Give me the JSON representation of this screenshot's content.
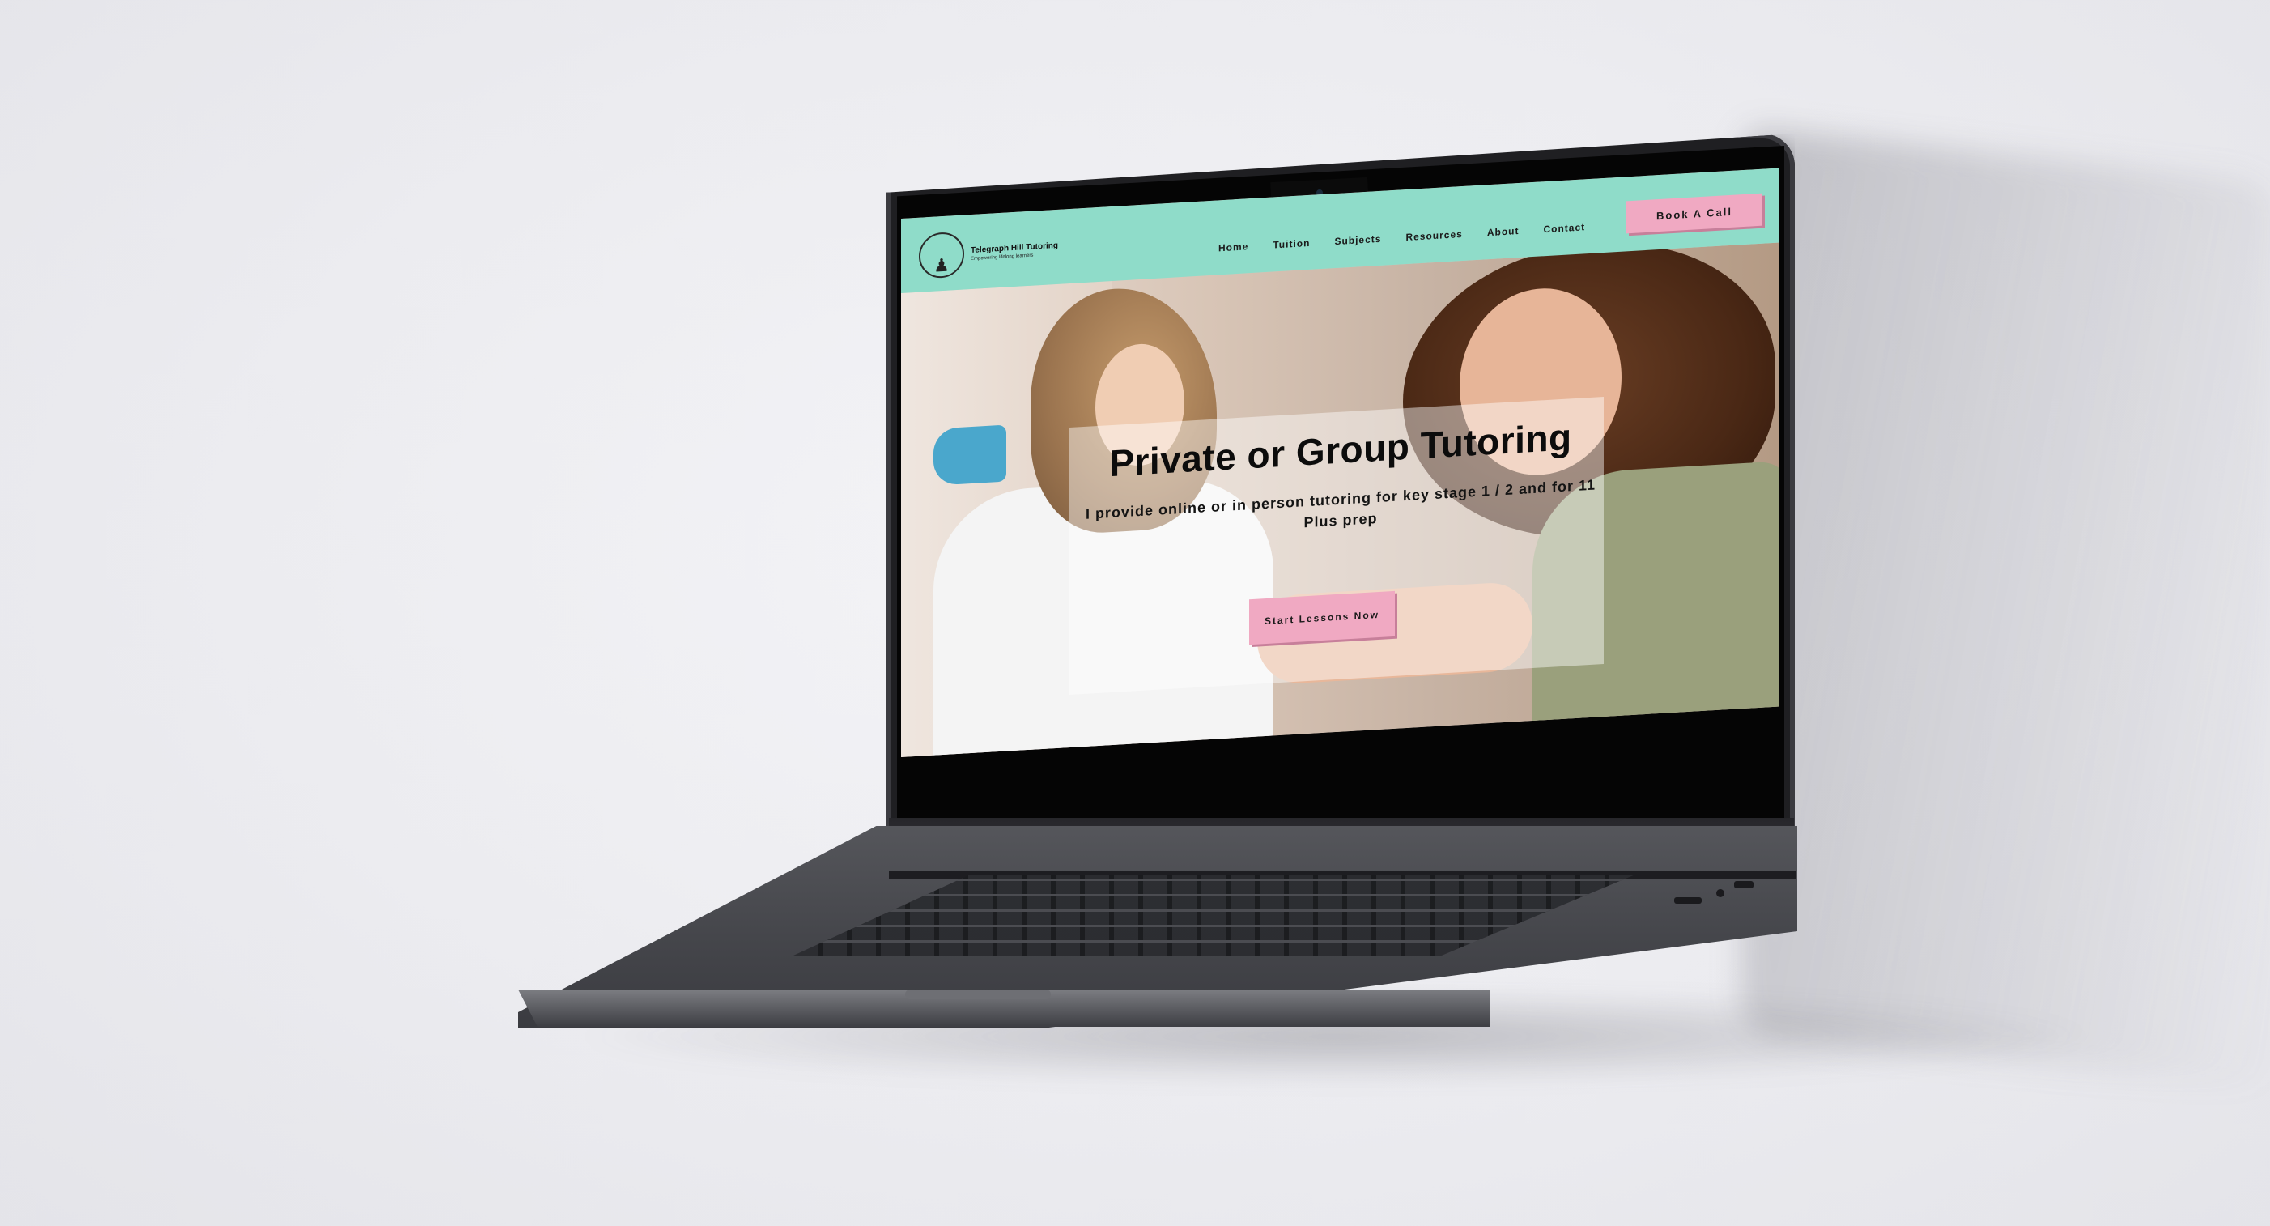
{
  "site": {
    "logo": {
      "title": "Telegraph Hill Tutoring",
      "subtitle": "Empowering lifelong learners"
    },
    "nav": [
      {
        "label": "Home"
      },
      {
        "label": "Tuition"
      },
      {
        "label": "Subjects"
      },
      {
        "label": "Resources"
      },
      {
        "label": "About"
      },
      {
        "label": "Contact"
      }
    ],
    "cta_label": "Book A Call",
    "hero": {
      "title": "Private or Group Tutoring",
      "subtitle": "I provide online or in person tutoring for key stage 1 / 2 and for 11 Plus prep",
      "button_label": "Start Lessons Now"
    }
  },
  "colors": {
    "header_bg": "#8fdcc9",
    "button_pink": "#f0a9c2",
    "laptop_body": "#45464b"
  },
  "icons": {
    "logo": "logo-circle-icon",
    "camera": "camera-icon"
  }
}
